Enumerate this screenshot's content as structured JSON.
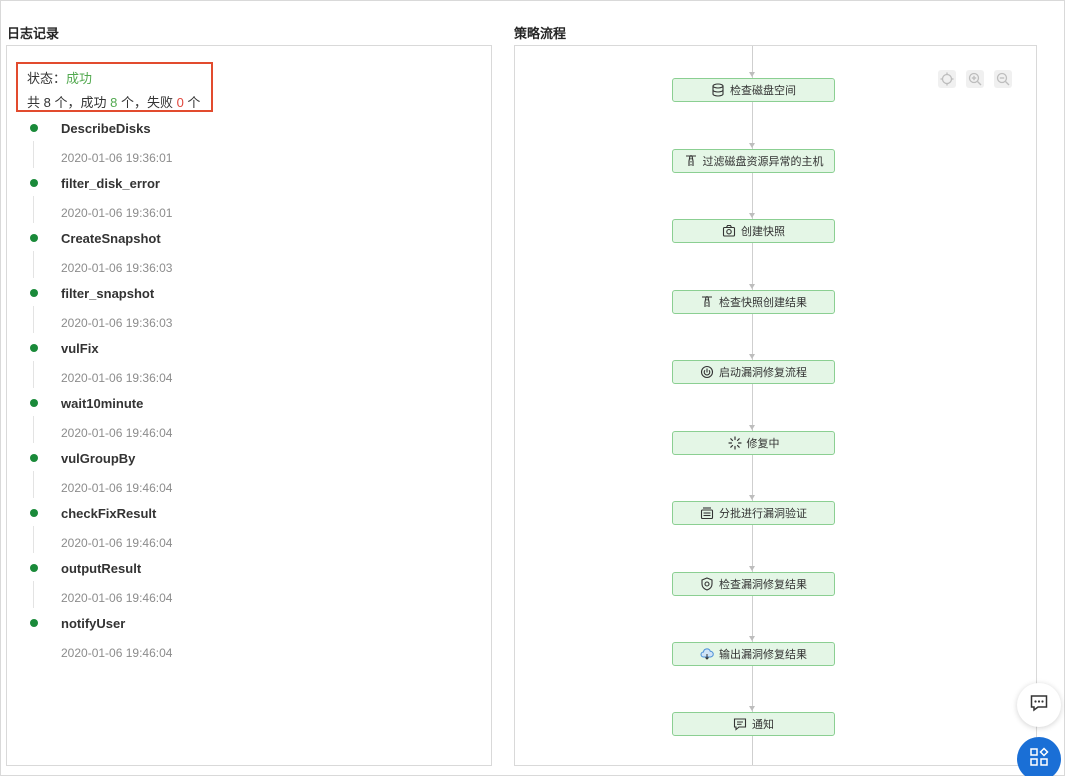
{
  "log": {
    "title": "日志记录",
    "status_label": "状态：",
    "status_value": "成功",
    "summary": {
      "total_prefix": "共 ",
      "total": "8",
      "total_suffix": " 个，成功 ",
      "success": "8",
      "success_suffix": " 个，失败 ",
      "failed": "0",
      "failed_suffix": " 个"
    },
    "entries": [
      {
        "name": "DescribeDisks",
        "time": "2020-01-06 19:36:01"
      },
      {
        "name": "filter_disk_error",
        "time": "2020-01-06 19:36:01"
      },
      {
        "name": "CreateSnapshot",
        "time": "2020-01-06 19:36:03"
      },
      {
        "name": "filter_snapshot",
        "time": "2020-01-06 19:36:03"
      },
      {
        "name": "vulFix",
        "time": "2020-01-06 19:36:04"
      },
      {
        "name": "wait10minute",
        "time": "2020-01-06 19:46:04"
      },
      {
        "name": "vulGroupBy",
        "time": "2020-01-06 19:46:04"
      },
      {
        "name": "checkFixResult",
        "time": "2020-01-06 19:46:04"
      },
      {
        "name": "outputResult",
        "time": "2020-01-06 19:46:04"
      },
      {
        "name": "notifyUser",
        "time": "2020-01-06 19:46:04"
      }
    ]
  },
  "flow": {
    "title": "策略流程",
    "tools": [
      "locate-icon",
      "zoom-in-icon",
      "zoom-out-icon"
    ],
    "nodes": [
      {
        "label": "检查磁盘空间",
        "icon": "database-icon"
      },
      {
        "label": "过滤磁盘资源异常的主机",
        "icon": "filter-icon"
      },
      {
        "label": "创建快照",
        "icon": "camera-icon"
      },
      {
        "label": "检查快照创建结果",
        "icon": "filter-icon"
      },
      {
        "label": "启动漏洞修复流程",
        "icon": "power-icon"
      },
      {
        "label": "修复中",
        "icon": "loading-icon"
      },
      {
        "label": "分批进行漏洞验证",
        "icon": "batch-icon"
      },
      {
        "label": "检查漏洞修复结果",
        "icon": "shield-check-icon"
      },
      {
        "label": "输出漏洞修复结果",
        "icon": "cloud-output-icon"
      },
      {
        "label": "通知",
        "icon": "message-icon"
      }
    ]
  },
  "floating": {
    "chat_icon": "chat-icon",
    "apps_icon": "apps-icon"
  },
  "colors": {
    "success": "#52a94f",
    "failure": "#e0463c",
    "highlight_border": "#e24b2e",
    "node_fill": "#e4f6e6",
    "node_border": "#8bcf92",
    "dot": "#1a8a3a",
    "apps_button": "#1a6fd6"
  }
}
